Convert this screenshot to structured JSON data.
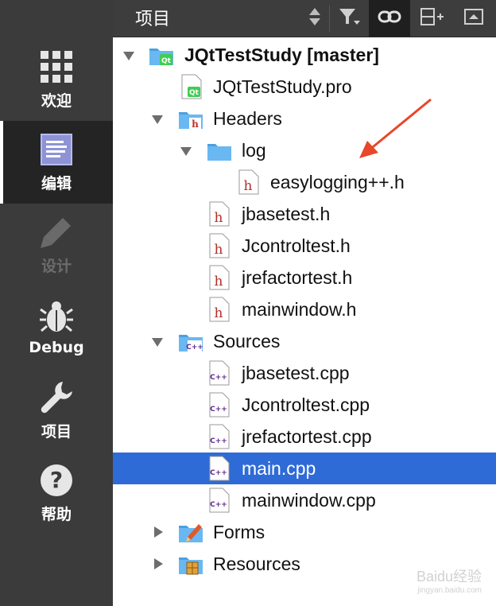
{
  "toolbar": {
    "title": "项目"
  },
  "sidebar": {
    "items": [
      {
        "label": "欢迎",
        "icon": "welcome-grid-icon",
        "state": "normal"
      },
      {
        "label": "编辑",
        "icon": "edit-document-icon",
        "state": "active"
      },
      {
        "label": "设计",
        "icon": "design-pencil-icon",
        "state": "disabled"
      },
      {
        "label": "Debug",
        "icon": "debug-bug-icon",
        "state": "normal"
      },
      {
        "label": "项目",
        "icon": "project-wrench-icon",
        "state": "normal"
      },
      {
        "label": "帮助",
        "icon": "help-question-icon",
        "state": "normal"
      }
    ]
  },
  "tree": {
    "rows": [
      {
        "label": "JQtTestStudy [master]",
        "icon": "qt-project-folder-icon",
        "expanded": true
      },
      {
        "label": "JQtTestStudy.pro",
        "icon": "qt-pro-file-icon"
      },
      {
        "label": "Headers",
        "icon": "headers-folder-icon",
        "expanded": true
      },
      {
        "label": "log",
        "icon": "folder-icon",
        "expanded": true
      },
      {
        "label": "easylogging++.h",
        "icon": "header-file-icon"
      },
      {
        "label": "jbasetest.h",
        "icon": "header-file-icon"
      },
      {
        "label": "Jcontroltest.h",
        "icon": "header-file-icon"
      },
      {
        "label": "jrefactortest.h",
        "icon": "header-file-icon"
      },
      {
        "label": "mainwindow.h",
        "icon": "header-file-icon"
      },
      {
        "label": "Sources",
        "icon": "sources-folder-icon",
        "expanded": true
      },
      {
        "label": "jbasetest.cpp",
        "icon": "cpp-file-icon"
      },
      {
        "label": "Jcontroltest.cpp",
        "icon": "cpp-file-icon"
      },
      {
        "label": "jrefactortest.cpp",
        "icon": "cpp-file-icon"
      },
      {
        "label": "main.cpp",
        "icon": "cpp-file-icon",
        "selected": true
      },
      {
        "label": "mainwindow.cpp",
        "icon": "cpp-file-icon"
      },
      {
        "label": "Forms",
        "icon": "forms-folder-icon",
        "expanded": false
      },
      {
        "label": "Resources",
        "icon": "resources-folder-icon",
        "expanded": false
      }
    ]
  },
  "watermark": {
    "text": "Baidu经验",
    "sub": "jingyan.baidu.com"
  },
  "colors": {
    "selection": "#2f6bd6",
    "sidebar": "#3b3b3b",
    "annotation_arrow": "#e8472b"
  }
}
